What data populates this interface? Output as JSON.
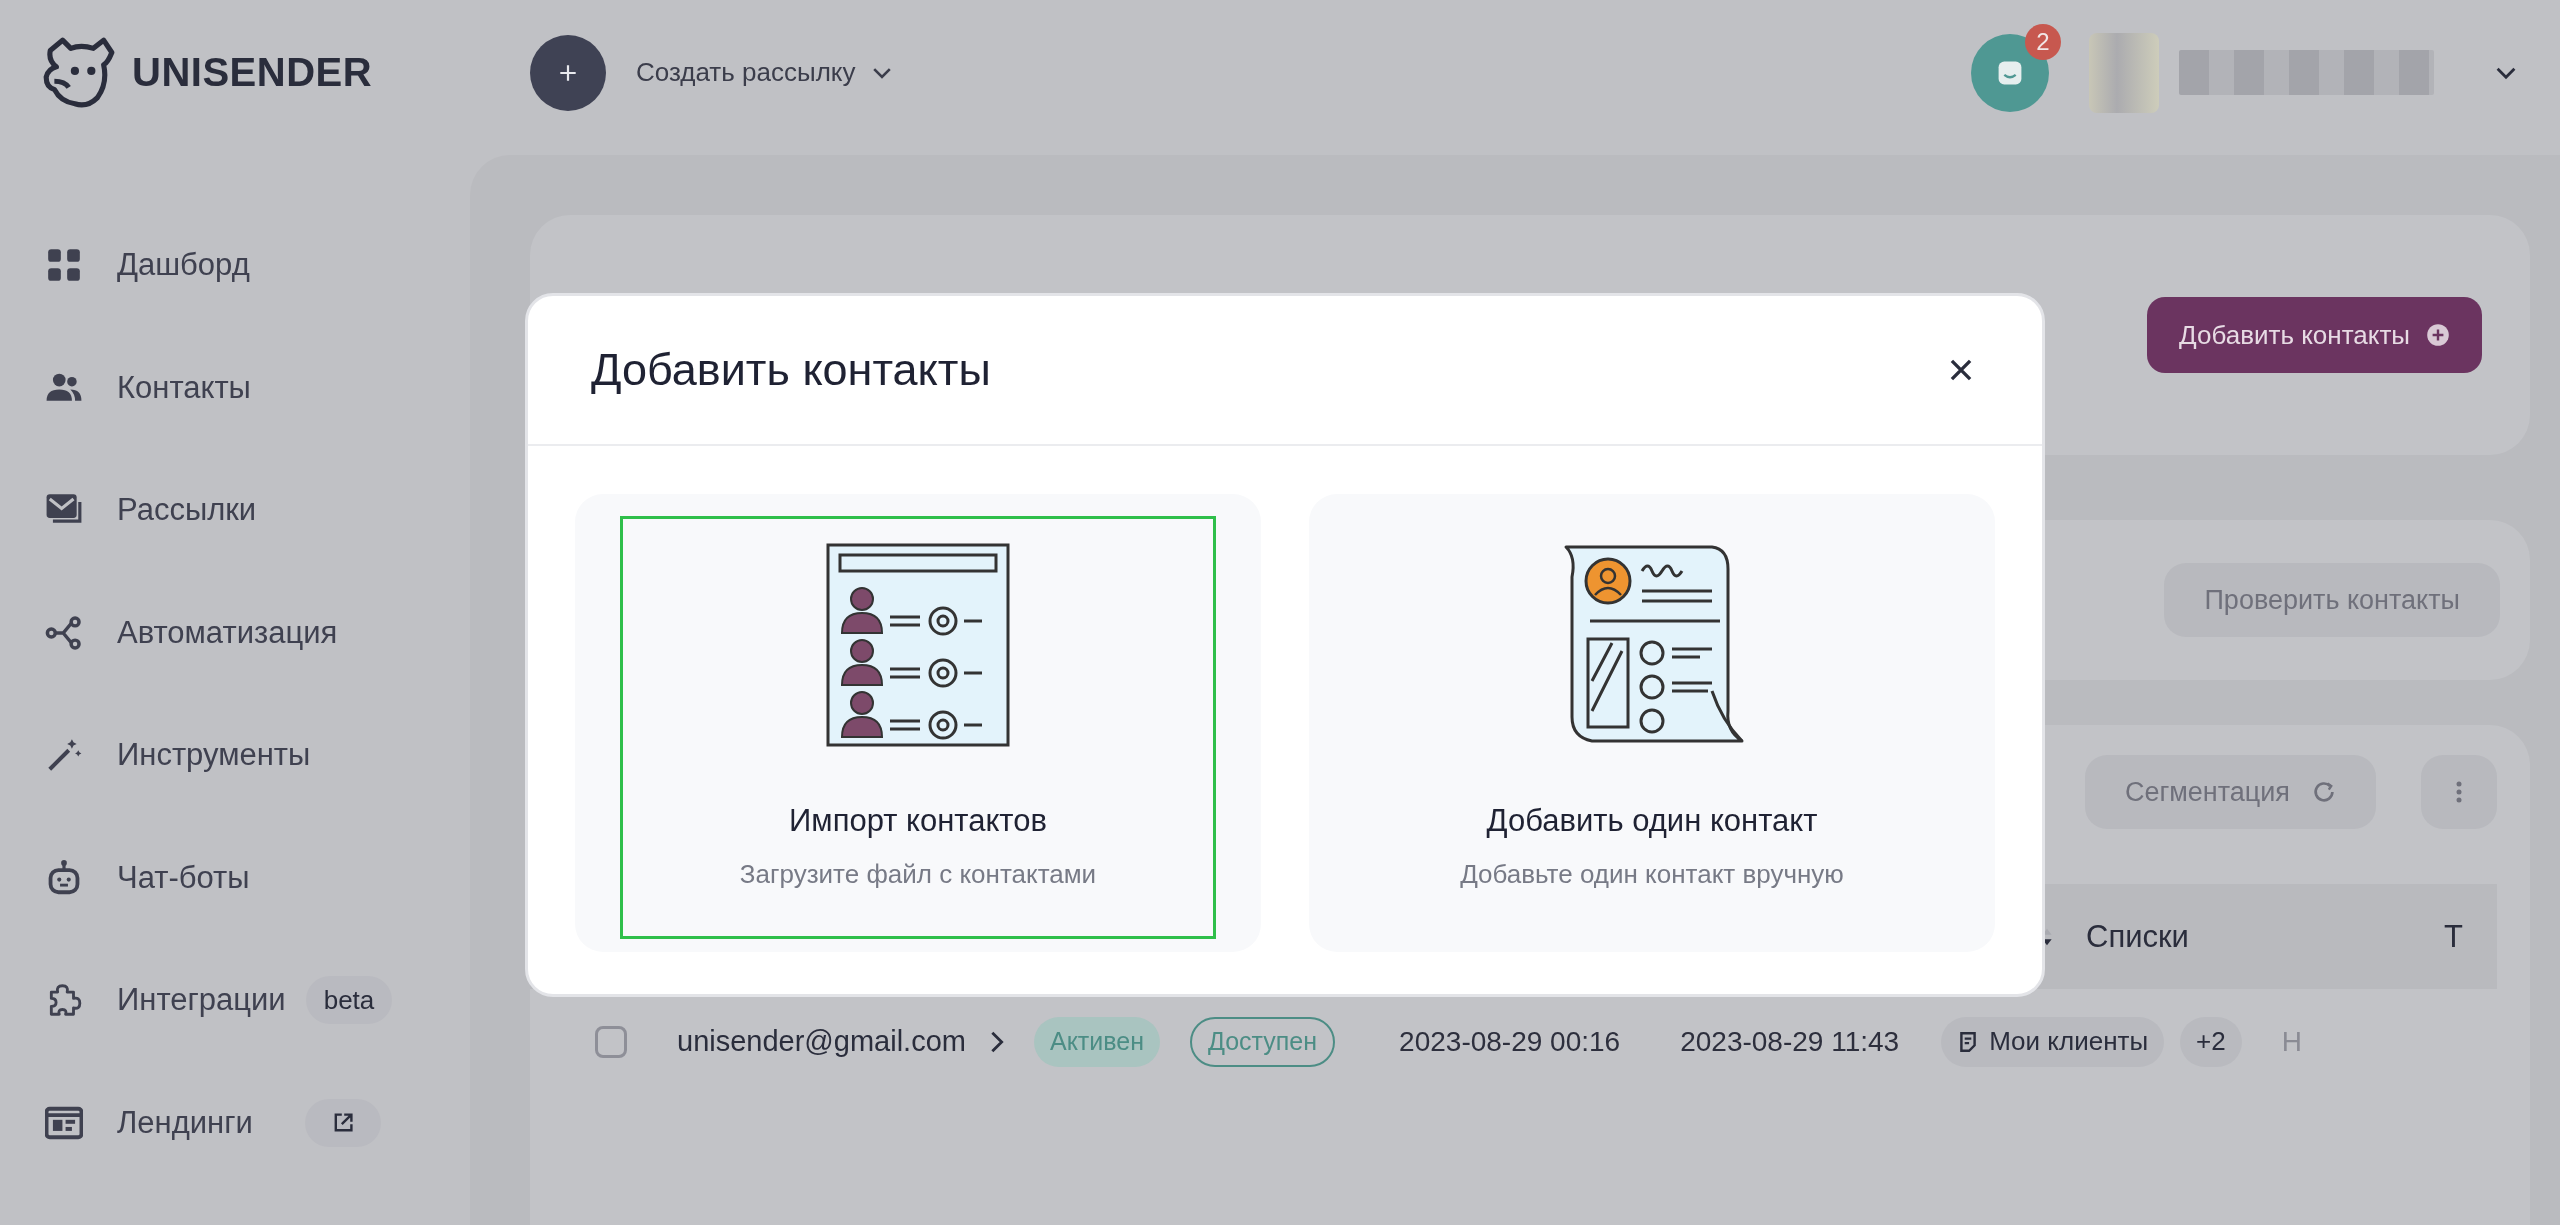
{
  "header": {
    "logo": "UNISENDER",
    "create_menu": "Создать рассылку",
    "notifications": {
      "count": "2"
    }
  },
  "sidebar": {
    "items": [
      {
        "label": "Дашборд"
      },
      {
        "label": "Контакты"
      },
      {
        "label": "Рассылки"
      },
      {
        "label": "Автоматизация"
      },
      {
        "label": "Инструменты"
      },
      {
        "label": "Чат-боты"
      },
      {
        "label": "Интеграции",
        "tag": "beta"
      },
      {
        "label": "Лендинги",
        "external": true
      }
    ]
  },
  "page": {
    "add_contacts_button": "Добавить контакты",
    "check_contacts_button": "Проверить контакты",
    "segmentation_button": "Сегментация",
    "table": {
      "columns": [
        "Списки",
        "Т"
      ],
      "rows": [
        {
          "checked": false,
          "email": "unisender@gmail.com",
          "statuses": [
            {
              "label": "Активен",
              "kind": "filled"
            },
            {
              "label": "Доступен",
              "kind": "outline"
            }
          ],
          "date_1": "2023-08-29 00:16",
          "date_2": "2023-08-29 11:43",
          "list": "Мои клиенты",
          "more_lists": "+2",
          "column_last": "Н"
        }
      ]
    }
  },
  "modal": {
    "title": "Добавить контакты",
    "options": [
      {
        "title": "Импорт контактов",
        "subtitle": "Загрузите файл с контактами",
        "selected": true
      },
      {
        "title": "Добавить один контакт",
        "subtitle": "Добавьте один контакт вручную",
        "selected": false
      }
    ]
  }
}
